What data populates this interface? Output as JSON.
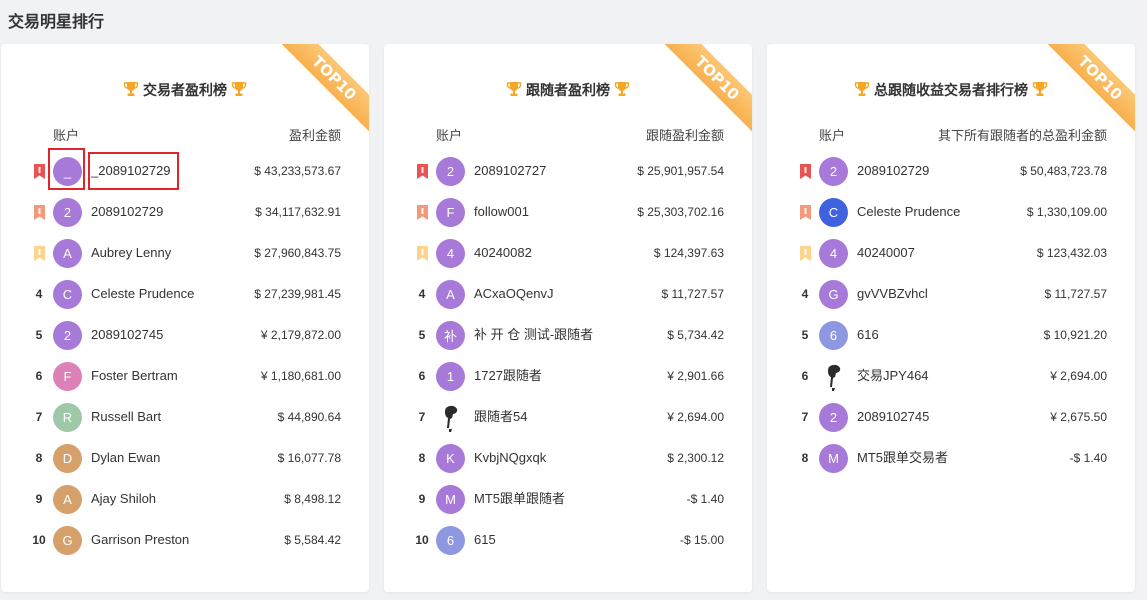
{
  "page_title": "交易明星排行",
  "ribbon_text": "TOP10",
  "colors": {
    "accent_ribbon": "#f8b04e",
    "highlight": "#e0242c",
    "trophy": "#f5a623"
  },
  "cards": [
    {
      "title": "交易者盈利榜",
      "col_account": "账户",
      "col_amount": "盈利金额",
      "rows": [
        {
          "rank": "1",
          "badge": "red",
          "avatar": "_",
          "avatar_color": "#a779d8",
          "name": "_2089102729",
          "amount": "$ 43,233,573.67"
        },
        {
          "rank": "2",
          "badge": "orange",
          "avatar": "2",
          "avatar_color": "#a779d8",
          "name": "2089102729",
          "amount": "$ 34,117,632.91"
        },
        {
          "rank": "3",
          "badge": "yellow",
          "avatar": "A",
          "avatar_color": "#a779d8",
          "name": "Aubrey Lenny",
          "amount": "$ 27,960,843.75"
        },
        {
          "rank": "4",
          "badge": "",
          "avatar": "C",
          "avatar_color": "#a779d8",
          "name": "Celeste Prudence",
          "amount": "$ 27,239,981.45"
        },
        {
          "rank": "5",
          "badge": "",
          "avatar": "2",
          "avatar_color": "#a779d8",
          "name": "2089102745",
          "amount": "¥ 2,179,872.00"
        },
        {
          "rank": "6",
          "badge": "",
          "avatar": "F",
          "avatar_color": "#dd82b8",
          "name": "Foster Bertram",
          "amount": "¥ 1,180,681.00"
        },
        {
          "rank": "7",
          "badge": "",
          "avatar": "R",
          "avatar_color": "#9ec8a8",
          "name": "Russell Bart",
          "amount": "$ 44,890.64"
        },
        {
          "rank": "8",
          "badge": "",
          "avatar": "D",
          "avatar_color": "#d6a06a",
          "name": "Dylan Ewan",
          "amount": "$ 16,077.78"
        },
        {
          "rank": "9",
          "badge": "",
          "avatar": "A",
          "avatar_color": "#d6a06a",
          "name": "Ajay Shiloh",
          "amount": "$ 8,498.12"
        },
        {
          "rank": "10",
          "badge": "",
          "avatar": "G",
          "avatar_color": "#d6a06a",
          "name": "Garrison Preston",
          "amount": "$ 5,584.42"
        }
      ]
    },
    {
      "title": "跟随者盈利榜",
      "col_account": "账户",
      "col_amount": "跟随盈利金额",
      "rows": [
        {
          "rank": "1",
          "badge": "red",
          "avatar": "2",
          "avatar_color": "#a779d8",
          "name": "2089102727",
          "amount": "$ 25,901,957.54"
        },
        {
          "rank": "2",
          "badge": "orange",
          "avatar": "F",
          "avatar_color": "#a779d8",
          "name": "follow001",
          "amount": "$ 25,303,702.16"
        },
        {
          "rank": "3",
          "badge": "yellow",
          "avatar": "4",
          "avatar_color": "#a779d8",
          "name": "40240082",
          "amount": "$ 124,397.63"
        },
        {
          "rank": "4",
          "badge": "",
          "avatar": "A",
          "avatar_color": "#a779d8",
          "name": "ACxaOQenvJ",
          "amount": "$ 11,727.57"
        },
        {
          "rank": "5",
          "badge": "",
          "avatar": "补",
          "avatar_color": "#a779d8",
          "name": "补 开 仓 测试-跟随者",
          "amount": "$ 5,734.42"
        },
        {
          "rank": "6",
          "badge": "",
          "avatar": "1",
          "avatar_color": "#a779d8",
          "name": "1727跟随者",
          "amount": "¥ 2,901.66"
        },
        {
          "rank": "7",
          "badge": "",
          "avatar": "",
          "avatar_color": "photo",
          "name": "跟随者54",
          "amount": "¥ 2,694.00"
        },
        {
          "rank": "8",
          "badge": "",
          "avatar": "K",
          "avatar_color": "#a779d8",
          "name": "KvbjNQgxqk",
          "amount": "$ 2,300.12"
        },
        {
          "rank": "9",
          "badge": "",
          "avatar": "M",
          "avatar_color": "#a779d8",
          "name": "MT5跟单跟随者",
          "amount": "-$ 1.40"
        },
        {
          "rank": "10",
          "badge": "",
          "avatar": "6",
          "avatar_color": "#8d98e0",
          "name": "615",
          "amount": "-$ 15.00"
        }
      ]
    },
    {
      "title": "总跟随收益交易者排行榜",
      "col_account": "账户",
      "col_amount": "其下所有跟随者的总盈利金额",
      "rows": [
        {
          "rank": "1",
          "badge": "red",
          "avatar": "2",
          "avatar_color": "#a779d8",
          "name": "2089102729",
          "amount": "$ 50,483,723.78"
        },
        {
          "rank": "2",
          "badge": "orange",
          "avatar": "C",
          "avatar_color": "#3f63e0",
          "name": "Celeste Prudence",
          "amount": "$ 1,330,109.00"
        },
        {
          "rank": "3",
          "badge": "yellow",
          "avatar": "4",
          "avatar_color": "#a779d8",
          "name": "40240007",
          "amount": "$ 123,432.03"
        },
        {
          "rank": "4",
          "badge": "",
          "avatar": "G",
          "avatar_color": "#a779d8",
          "name": "gvVVBZvhcl",
          "amount": "$ 11,727.57"
        },
        {
          "rank": "5",
          "badge": "",
          "avatar": "6",
          "avatar_color": "#8d98e0",
          "name": "616",
          "amount": "$ 10,921.20"
        },
        {
          "rank": "6",
          "badge": "",
          "avatar": "",
          "avatar_color": "photo",
          "name": "交易JPY464",
          "amount": "¥ 2,694.00"
        },
        {
          "rank": "7",
          "badge": "",
          "avatar": "2",
          "avatar_color": "#a779d8",
          "name": "2089102745",
          "amount": "¥ 2,675.50"
        },
        {
          "rank": "8",
          "badge": "",
          "avatar": "M",
          "avatar_color": "#a779d8",
          "name": "MT5跟单交易者",
          "amount": "-$ 1.40"
        }
      ]
    }
  ]
}
